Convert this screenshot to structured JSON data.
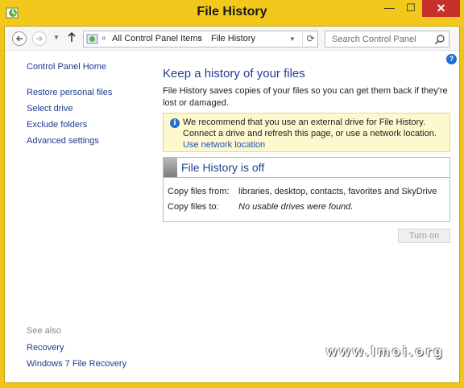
{
  "window": {
    "title": "File History"
  },
  "titlebar": {
    "minimize": "—",
    "maximize": "☐",
    "close": "✕"
  },
  "navigation": {
    "breadcrumb": [
      "All Control Panel Items",
      "File History"
    ],
    "search_placeholder": "Search Control Panel"
  },
  "sidebar": {
    "home": "Control Panel Home",
    "links": [
      "Restore personal files",
      "Select drive",
      "Exclude folders",
      "Advanced settings"
    ],
    "see_also_label": "See also",
    "see_also_links": [
      "Recovery",
      "Windows 7 File Recovery"
    ]
  },
  "main": {
    "heading": "Keep a history of your files",
    "description": "File History saves copies of your files so you can get them back if they're lost or damaged.",
    "info": {
      "message": "We recommend that you use an external drive for File History. Connect a drive and refresh this page, or use a network location.",
      "link": "Use network location"
    },
    "status": {
      "title": "File History is off",
      "rows": [
        {
          "label": "Copy files from:",
          "value": "libraries, desktop, contacts, favorites and SkyDrive"
        },
        {
          "label": "Copy files to:",
          "value": "No usable drives were found."
        }
      ]
    },
    "turn_on_button": "Turn on"
  },
  "watermark": "www.lmoi.org",
  "colors": {
    "titlebar": "#f2c81c",
    "close_button": "#c7302b",
    "link": "#1a3c8b",
    "heading": "#1e3f8e",
    "info_background": "#fdf8cd"
  }
}
